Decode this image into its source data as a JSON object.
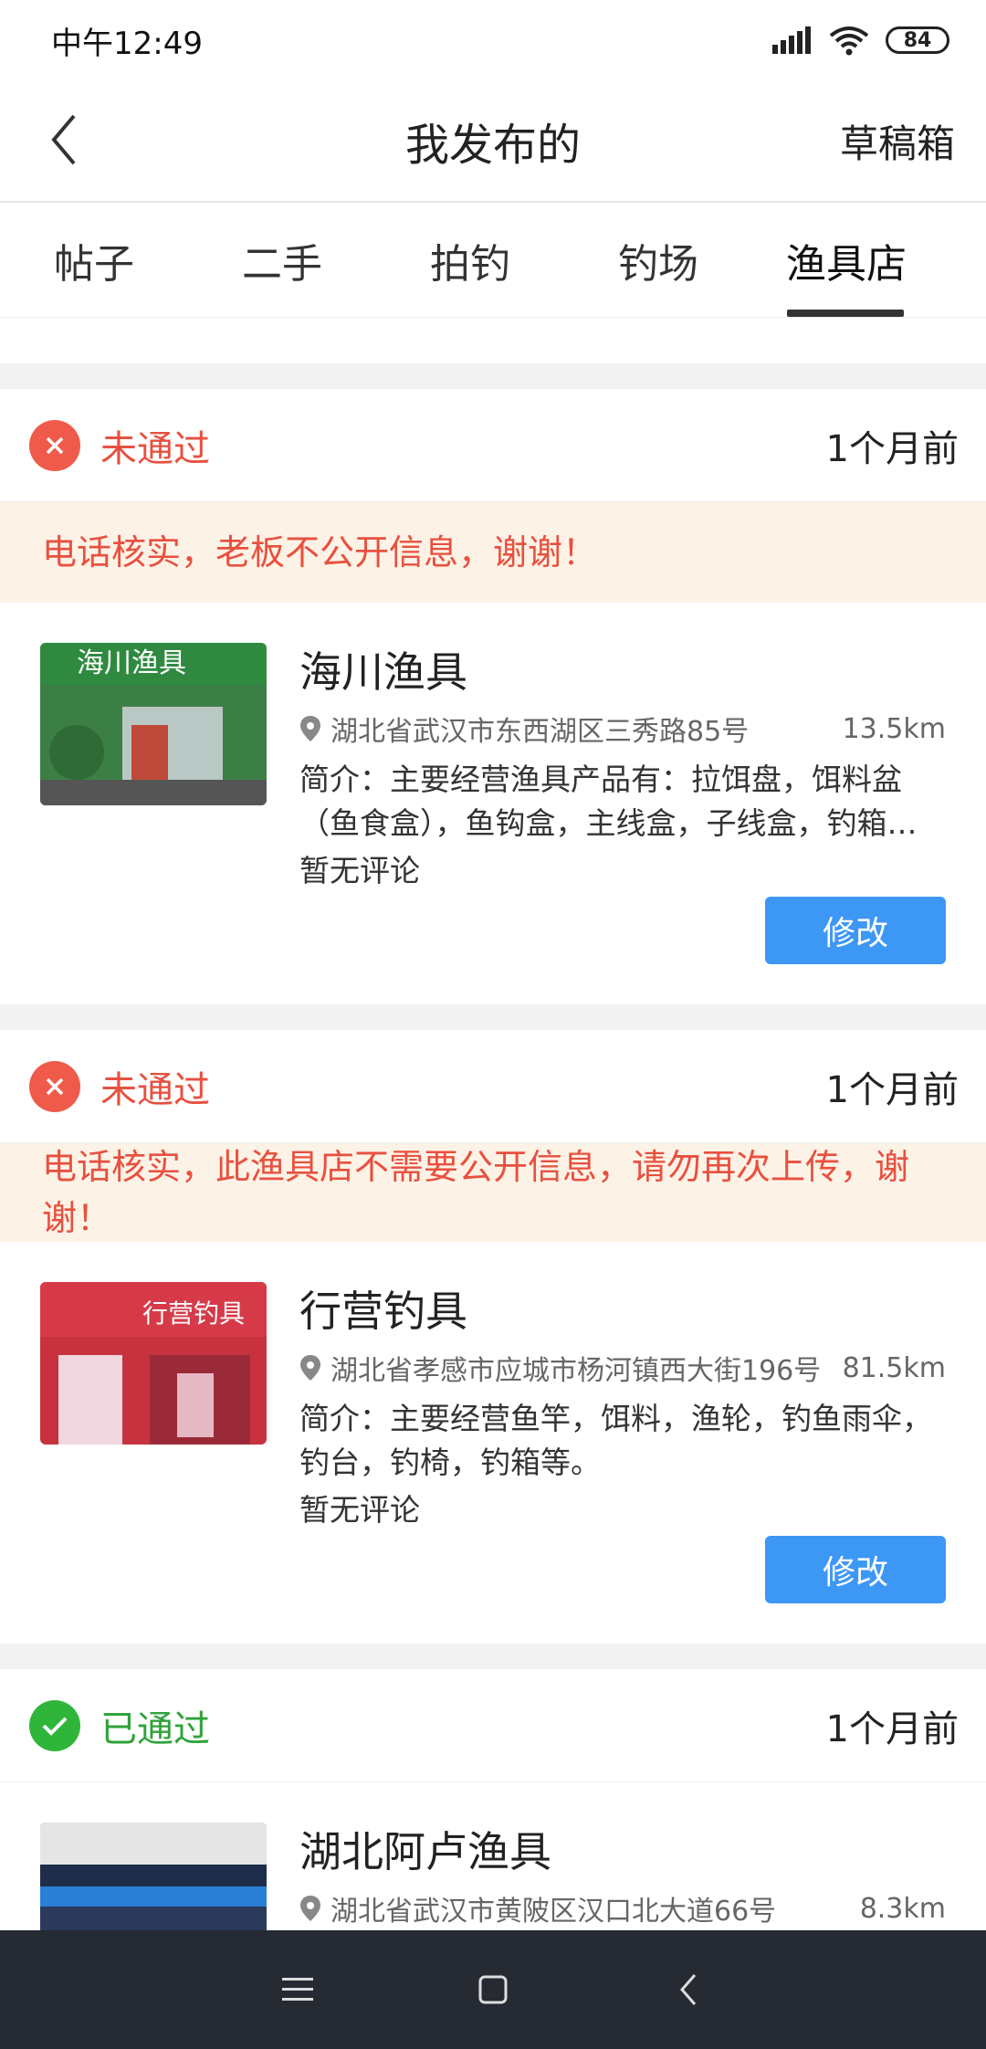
{
  "status_bar": {
    "time": "中午12:49",
    "battery": "84"
  },
  "header": {
    "title": "我发布的",
    "draft_label": "草稿箱"
  },
  "tabs": [
    {
      "label": "帖子"
    },
    {
      "label": "二手"
    },
    {
      "label": "拍钓"
    },
    {
      "label": "钓场"
    },
    {
      "label": "渔具店"
    }
  ],
  "active_tab": "渔具店",
  "posts": [
    {
      "status": "未通过",
      "time": "1个月前",
      "reason": "电话核实，老板不公开信息，谢谢！",
      "shop_name": "海川渔具",
      "address": "湖北省武汉市东西湖区三秀路85号",
      "distance": "13.5km",
      "intro": "简介：主要经营渔具产品有：拉饵盘，饵料盆（鱼食盒），鱼钩盒，主线盒，子线盒，钓箱…",
      "review": "暂无评论",
      "edit_label": "修改"
    },
    {
      "status": "未通过",
      "time": "1个月前",
      "reason": "电话核实，此渔具店不需要公开信息，请勿再次上传，谢谢！",
      "shop_name": "行营钓具",
      "address": "湖北省孝感市应城市杨河镇西大街196号",
      "distance": "81.5km",
      "intro": "简介：主要经营鱼竿，饵料，渔轮，钓鱼雨伞，钓台，钓椅，钓箱等。",
      "review": "暂无评论",
      "edit_label": "修改"
    },
    {
      "status": "已通过",
      "time": "1个月前",
      "shop_name": "湖北阿卢渔具",
      "address": "湖北省武汉市黄陂区汉口北大道66号",
      "distance": "8.3km"
    }
  ],
  "colors": {
    "reject": "#e8503f",
    "pass": "#2fa33a",
    "button": "#3d97f5",
    "reason_bg": "#fdf2e6"
  }
}
